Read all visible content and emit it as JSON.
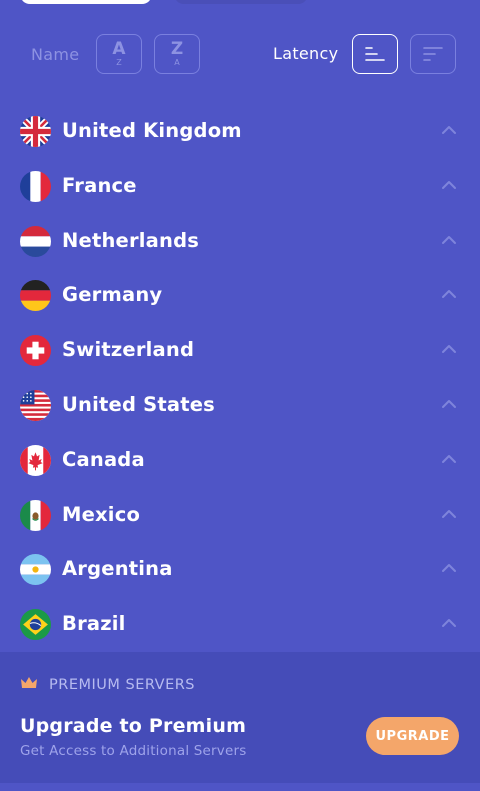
{
  "sort": {
    "name_label": "Name",
    "az": {
      "big": "A",
      "small": "Z"
    },
    "za": {
      "big": "Z",
      "small": "A"
    },
    "latency_label": "Latency"
  },
  "servers": [
    {
      "name": "United Kingdom",
      "flag": "uk-flag-icon"
    },
    {
      "name": "France",
      "flag": "france-flag-icon"
    },
    {
      "name": "Netherlands",
      "flag": "netherlands-flag-icon"
    },
    {
      "name": "Germany",
      "flag": "germany-flag-icon"
    },
    {
      "name": "Switzerland",
      "flag": "switzerland-flag-icon"
    },
    {
      "name": "United States",
      "flag": "usa-flag-icon"
    },
    {
      "name": "Canada",
      "flag": "canada-flag-icon"
    },
    {
      "name": "Mexico",
      "flag": "mexico-flag-icon"
    },
    {
      "name": "Argentina",
      "flag": "argentina-flag-icon"
    },
    {
      "name": "Brazil",
      "flag": "brazil-flag-icon"
    }
  ],
  "premium": {
    "section_title": "PREMIUM SERVERS",
    "heading": "Upgrade to Premium",
    "subtitle": "Get Access to Additional Servers",
    "button_label": "UPGRADE"
  },
  "colors": {
    "background": "#4f55c6",
    "panel": "#454cb8",
    "accent": "#f4a66a",
    "crown": "#f4a66a"
  }
}
